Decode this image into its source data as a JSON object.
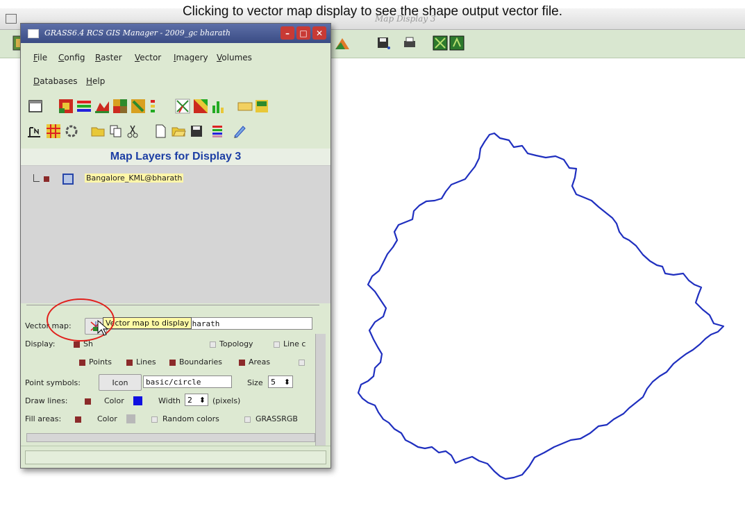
{
  "caption": "Clicking to vector map display to see the shape output vector file.",
  "map_display": {
    "title": "Map Display 3",
    "toolbar_icons": [
      "map-icon",
      "layer-icon",
      "save-icon",
      "print-icon",
      "zoom-region-icon",
      "zoom-default-icon"
    ],
    "boundary_color": "#1f2fbf"
  },
  "gis_manager": {
    "title": "GRASS6.4 RCS GIS Manager - 2009_gc bharath",
    "window_buttons": {
      "minimize": "–",
      "maximize": "□",
      "close": "✕"
    },
    "menu": [
      "File",
      "Config",
      "Raster",
      "Vector",
      "Imagery",
      "Volumes",
      "Databases",
      "Help"
    ],
    "panel_title": "Map Layers for Display 3",
    "layer": {
      "label": "Bangalore_KML@bharath"
    },
    "vector_map": {
      "label": "Vector map:",
      "value": "Bangalore_Shape@bharath",
      "tooltip": "Vector map to display"
    },
    "display": {
      "label": "Display:",
      "options": [
        {
          "label": "Sh",
          "checked": true
        },
        {
          "label": "Topology",
          "checked": false
        },
        {
          "label": "Line c",
          "checked": false
        }
      ]
    },
    "features": [
      {
        "label": "Points",
        "checked": true
      },
      {
        "label": "Lines",
        "checked": true
      },
      {
        "label": "Boundaries",
        "checked": true
      },
      {
        "label": "Areas",
        "checked": true
      }
    ],
    "point_symbols": {
      "label": "Point symbols:",
      "button": "Icon",
      "value": "basic/circle",
      "size_label": "Size",
      "size": "5"
    },
    "draw_lines": {
      "label": "Draw lines:",
      "color_label": "Color",
      "color": "#1010e0",
      "width_label": "Width",
      "width": "2",
      "unit": "(pixels)"
    },
    "fill_areas": {
      "label": "Fill areas:",
      "color_label": "Color",
      "color": "#b8b8b8",
      "random_label": "Random colors",
      "grassrgb_label": "GRASSRGB"
    }
  },
  "colors": {
    "highlight_circle": "#e0201c",
    "panel_title": "#1c3ea4"
  }
}
